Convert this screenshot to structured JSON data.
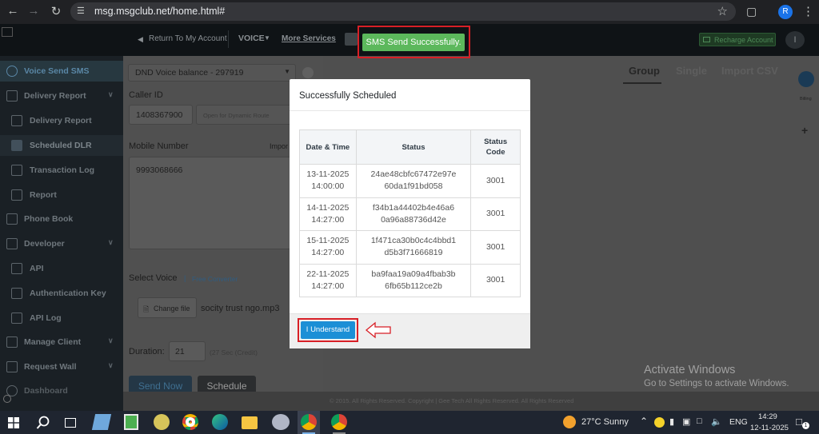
{
  "browser": {
    "url": "msg.msgclub.net/home.html#",
    "profile_initial": "R"
  },
  "topnav": {
    "return_label": "Return To My Account",
    "voice_label": "VOICE",
    "more_services": "More Services",
    "recharge_label": "Recharge Account"
  },
  "toast": {
    "message": "SMS Send Successfully."
  },
  "sidebar": {
    "items": [
      {
        "label": "Voice Send SMS"
      },
      {
        "label": "Delivery Report"
      },
      {
        "label": "Delivery Report"
      },
      {
        "label": "Scheduled DLR"
      },
      {
        "label": "Transaction Log"
      },
      {
        "label": "Report"
      },
      {
        "label": "Phone Book"
      },
      {
        "label": "Developer"
      },
      {
        "label": "API"
      },
      {
        "label": "Authentication Key"
      },
      {
        "label": "API Log"
      },
      {
        "label": "Manage Client"
      },
      {
        "label": "Request Wall"
      },
      {
        "label": "Dashboard"
      }
    ]
  },
  "form": {
    "balance": "DND Voice balance - 297919",
    "caller_id_label": "Caller ID",
    "caller_id_value": "1408367900",
    "dynamic_placeholder": "Open for Dynamic Route",
    "mobile_label": "Mobile Number",
    "import_label": "Impor",
    "mobile_value": "9993068666",
    "select_voice_label": "Select Voice",
    "free_converter": "Free Converter",
    "change_file": "Change file",
    "file_name": "socity trust ngo.mp3",
    "duration_label": "Duration:",
    "duration_value": "21",
    "duration_hint": "(27 Sec (Credit)",
    "send_now": "Send Now",
    "schedule": "Schedule"
  },
  "tabs": {
    "group": "Group",
    "single": "Single",
    "import": "Import CSV"
  },
  "right_rail": {
    "label": "Billing"
  },
  "footer_text": "© 2015. All Rights Reserved. Copyright | Gee Tech All Rights Reserved. All Rights Reserved",
  "modal": {
    "title": "Successfully Scheduled",
    "headers": [
      "Date & Time",
      "Status",
      "Status Code"
    ],
    "rows": [
      {
        "date": "13-11-2025",
        "time": "14:00:00",
        "status1": "24ae48cbfc67472e97e",
        "status2": "60da1f91bd058",
        "code": "3001"
      },
      {
        "date": "14-11-2025",
        "time": "14:27:00",
        "status1": "f34b1a44402b4e46a6",
        "status2": "0a96a88736d42e",
        "code": "3001"
      },
      {
        "date": "15-11-2025",
        "time": "14:27:00",
        "status1": "1f471ca30b0c4c4bbd1",
        "status2": "d5b3f71666819",
        "code": "3001"
      },
      {
        "date": "22-11-2025",
        "time": "14:27:00",
        "status1": "ba9faa19a09a4fbab3b",
        "status2": "6fb65b112ce2b",
        "code": "3001"
      }
    ],
    "button": "I Understand"
  },
  "activate": {
    "line1": "Activate Windows",
    "line2": "Go to Settings to activate Windows."
  },
  "taskbar": {
    "weather": "27°C  Sunny",
    "lang": "ENG",
    "time": "14:29",
    "date": "12-11-2025",
    "notif_count": "1"
  },
  "colors": {
    "highlight": "#d81f26",
    "toast": "#5cb85c",
    "primary_button": "#1b8fd6"
  }
}
